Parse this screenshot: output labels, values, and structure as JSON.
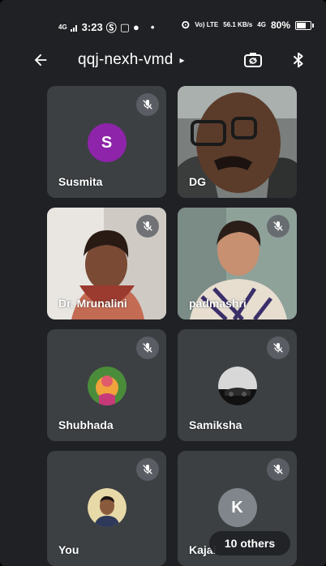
{
  "status_bar": {
    "network": "4G",
    "time": "3:23",
    "vol_lte": "Vo) LTE",
    "speed": "56.1 KB/s",
    "net2": "4G",
    "battery": "80%"
  },
  "header": {
    "meeting_code": "qqj-nexh-vmd",
    "caret": "▸"
  },
  "participants": [
    {
      "name": "Susmita",
      "initial": "S",
      "muted": true,
      "avatar_color": "#8e24aa"
    },
    {
      "name": "DG",
      "muted": false
    },
    {
      "name": "Dr. Mrunalini",
      "muted": true
    },
    {
      "name": "padmashri",
      "muted": true
    },
    {
      "name": "Shubhada",
      "muted": true
    },
    {
      "name": "Samiksha",
      "muted": true
    },
    {
      "name": "You",
      "muted": true
    },
    {
      "name": "Kajal",
      "initial": "K",
      "muted": true,
      "avatar_color": "#80868b"
    }
  ],
  "others_chip": "10 others",
  "colors": {
    "background": "#202124",
    "tile": "#3c4043",
    "mute_bg": "#5f6368"
  }
}
